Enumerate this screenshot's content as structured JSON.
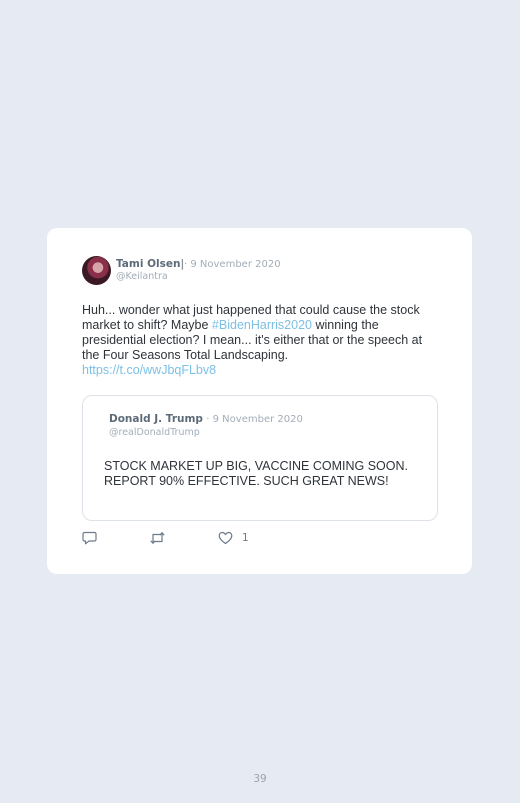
{
  "tweet": {
    "author_name": "Tami Olsen",
    "author_separator": "|",
    "date": "· 9 November 2020",
    "handle": "@Keilantra",
    "text_before_hashtag": "Huh... wonder what just happened that could cause the stock market to shift? Maybe ",
    "hashtag": "#BidenHarris2020",
    "text_after_hashtag": " winning the presidential election? I mean... it's either that or the speech at the Four Seasons Total Landscaping.",
    "link": "https://t.co/wwJbqFLbv8"
  },
  "quoted_tweet": {
    "author_name": "Donald J. Trump",
    "date": "· 9 November 2020",
    "handle": "@realDonaldTrump",
    "text": "STOCK MARKET UP BIG, VACCINE COMING SOON. REPORT 90% EFFECTIVE. SUCH GREAT NEWS!"
  },
  "actions": {
    "reply_icon": "reply-icon",
    "retweet_icon": "retweet-icon",
    "like_icon": "heart-icon",
    "like_count": "1"
  },
  "page_number": "39"
}
